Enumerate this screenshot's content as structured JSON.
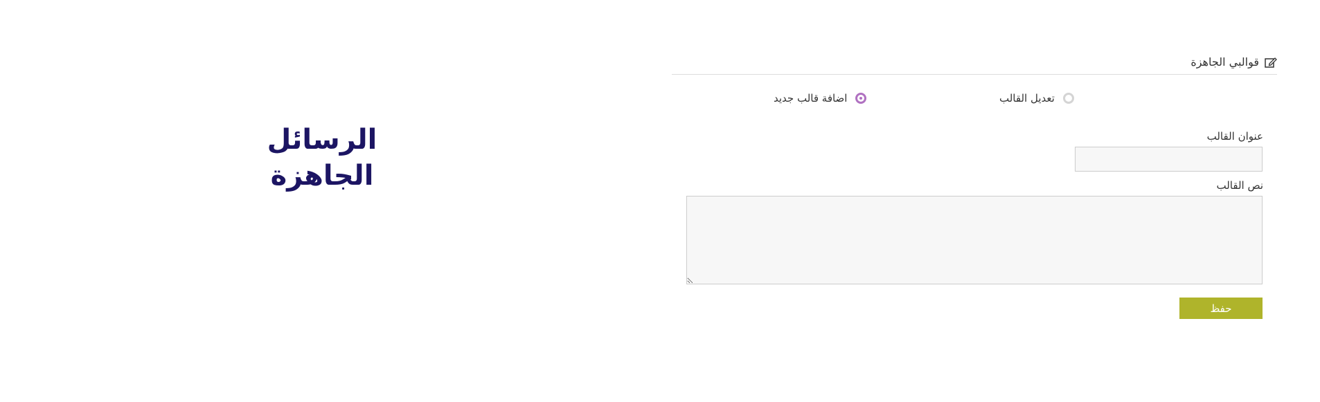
{
  "page": {
    "heading": "الرسائل الجاهزة"
  },
  "section": {
    "title": "قوالبي الجاهزة",
    "icon": "edit-icon"
  },
  "radio_options": {
    "edit_template": {
      "label": "تعديل القالب",
      "checked": false
    },
    "add_template": {
      "label": "اضافة قالب جديد",
      "checked": true
    }
  },
  "form": {
    "title_label": "عنوان القالب",
    "title_value": "",
    "body_label": "نص القالب",
    "body_value": "",
    "save_label": "حفظ"
  },
  "colors": {
    "heading": "#1c1563",
    "accent_radio": "#b071c1",
    "save_button": "#afb42b",
    "input_background": "#f7f7f7"
  }
}
